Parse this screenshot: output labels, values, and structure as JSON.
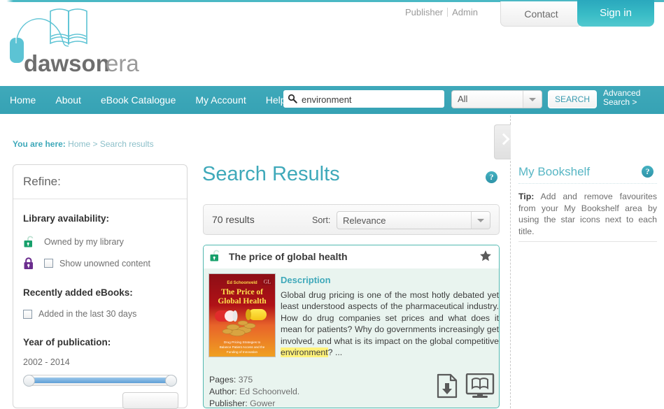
{
  "top": {
    "publisher": "Publisher",
    "admin": "Admin",
    "contact": "Contact",
    "signin": "Sign in"
  },
  "brand": {
    "name_bold": "dawson",
    "name_light": "era"
  },
  "nav": {
    "items": [
      "Home",
      "About",
      "eBook Catalogue",
      "My Account",
      "Help"
    ],
    "search_value": "environment",
    "search_placeholder": "",
    "scope_selected": "All",
    "search_button": "SEARCH",
    "advanced_search": "Advanced Search >"
  },
  "breadcrumb": {
    "prefix": "You are here:",
    "home": "Home",
    "separator": ">",
    "current": "Search results"
  },
  "refine": {
    "heading": "Refine:",
    "library_availability_heading": "Library availability:",
    "owned_label": "Owned by my library",
    "unowned_label": "Show unowned content",
    "recently_added_heading": "Recently added eBooks:",
    "added_last_30_label": "Added in the last 30 days",
    "year_heading": "Year of publication:",
    "year_range": "2002 - 2014"
  },
  "results": {
    "title": "Search Results",
    "count": "70 results",
    "sort_label": "Sort:",
    "sort_selected": "Relevance"
  },
  "result_item": {
    "title": "The price of global health",
    "description_heading": "Description",
    "description_pre": "Global drug pricing is one of the most hotly debated yet least understood aspects of the pharmaceutical industry. How do drug companies set prices and what does it mean for patients? Why do governments increasingly get involved, and what is its impact on the global competitive ",
    "description_highlight": "environment",
    "description_post": "? ...",
    "pages_key": "Pages:",
    "pages_value": "375",
    "author_key": "Author:",
    "author_value": "Ed Schoonveld.",
    "publisher_key": "Publisher:",
    "publisher_value": "Gower",
    "cover": {
      "author": "Ed Schoonveld",
      "title_line1": "The Price of",
      "title_line2": "Global Health",
      "subtitle_line1": "Drug Pricing Strategies to",
      "subtitle_line2": "Balance Patient Access and the",
      "subtitle_line3": "Funding of Innovation"
    }
  },
  "bookshelf": {
    "title": "My Bookshelf",
    "tip_label": "Tip:",
    "tip_text": " Add and remove favourites from your My Bookshelf area by using the star icons next to each title."
  },
  "icons": {
    "help": "?",
    "search": "search-icon",
    "star": "star-icon",
    "download": "download-icon",
    "read_online": "read-online-icon",
    "lock_open": "lock-open-icon",
    "lock_closed": "lock-closed-icon"
  },
  "colors": {
    "teal": "#3fa9ba",
    "teal_dark": "#2f93a8",
    "card_border": "#52b8b0",
    "card_bg": "#e9f4ef",
    "highlight": "#fff27a",
    "lock_green": "#17a06b",
    "lock_purple": "#6b2d8e"
  }
}
